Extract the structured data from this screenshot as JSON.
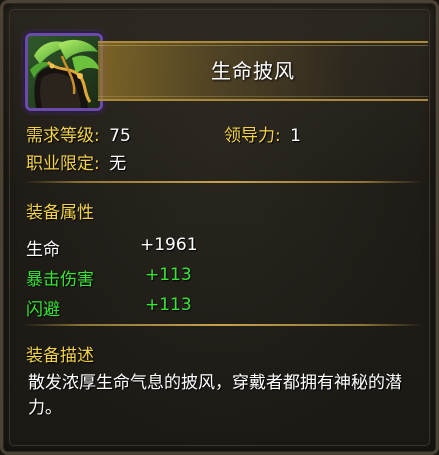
{
  "item": {
    "name": "生命披风",
    "icon": "cloak-icon"
  },
  "requirements": {
    "level_label": "需求等级:",
    "level_value": "75",
    "leadership_label": "领导力:",
    "leadership_value": "1",
    "class_label": "职业限定:",
    "class_value": "无"
  },
  "attributes": {
    "title": "装备属性",
    "rows": [
      {
        "name": "生命",
        "value": "+1961",
        "color": "#ffffff"
      },
      {
        "name": "暴击伤害",
        "value": "+113",
        "color": "#37e635"
      },
      {
        "name": "闪避",
        "value": "+113",
        "color": "#37e635"
      }
    ]
  },
  "description": {
    "title": "装备描述",
    "text": "散发浓厚生命气息的披风，穿戴者都拥有神秘的潜力。"
  },
  "colors": {
    "label": "#f2d24a",
    "bonus": "#37e635",
    "base": "#ffffff",
    "frame": "#6b4aa8"
  }
}
